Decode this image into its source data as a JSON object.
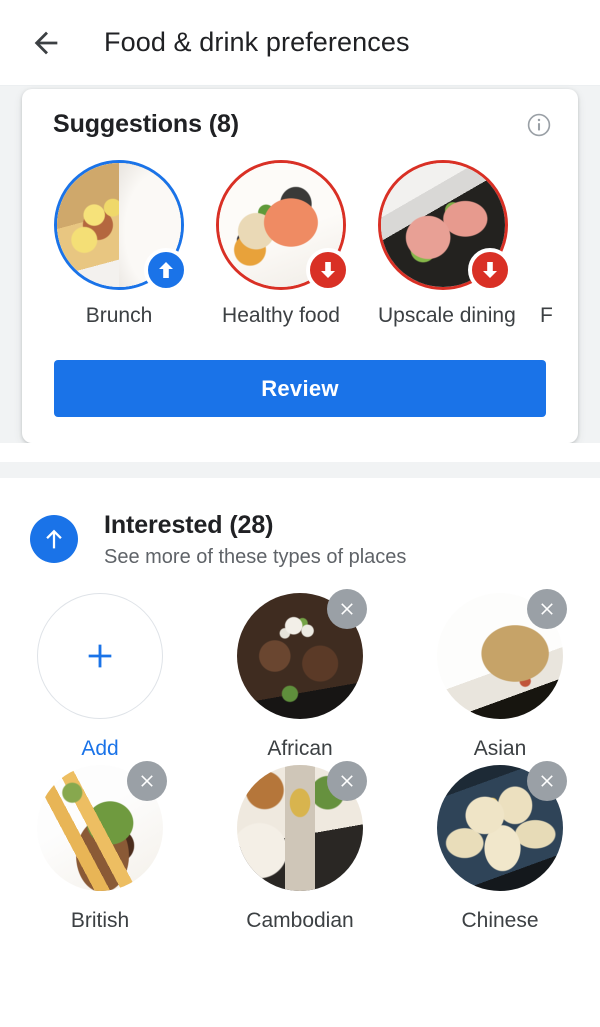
{
  "appbar": {
    "back_icon": "arrow-left-icon",
    "title": "Food & drink preferences"
  },
  "suggestions_card": {
    "title": "Suggestions (8)",
    "info_icon": "info-icon",
    "items": [
      {
        "label": "Brunch",
        "badge": "arrow-up-icon",
        "badge_color": "#1a73e8",
        "ring_color": "#1a73e8",
        "photo": "eggs-benedict-waffle"
      },
      {
        "label": "Healthy food",
        "badge": "arrow-down-icon",
        "badge_color": "#d93025",
        "ring_color": "#d93025",
        "photo": "salmon-fillet-plate"
      },
      {
        "label": "Upscale dining",
        "badge": "arrow-down-icon",
        "badge_color": "#d93025",
        "ring_color": "#d93025",
        "photo": "tuna-rolls-dark-plate"
      },
      {
        "label": "F",
        "badge": "arrow-down-icon",
        "badge_color": "#d93025",
        "ring_color": "#d93025",
        "photo": "clipped-offscreen"
      }
    ],
    "review_label": "Review"
  },
  "interested_section": {
    "icon": "arrow-up-circle-icon",
    "title": "Interested (28)",
    "subtitle": "See more of these types of places",
    "add_tile": {
      "icon": "plus-icon",
      "label": "Add"
    },
    "remove_icon": "close-icon",
    "tiles": [
      {
        "label": "African",
        "photo": "grilled-meat-onions"
      },
      {
        "label": "Asian",
        "photo": "fried-rice-plate"
      },
      {
        "label": "British",
        "photo": "steak-rosemary-chips"
      },
      {
        "label": "Cambodian",
        "photo": "stone-vessel-dish"
      },
      {
        "label": "Chinese",
        "photo": "soup-dumplings"
      }
    ]
  },
  "colors": {
    "accent_blue": "#1a73e8",
    "alert_red": "#d93025",
    "text_primary": "#202124",
    "text_secondary": "#5f6368",
    "badge_gray": "#9aa0a6",
    "background_gray": "#f1f3f4"
  }
}
